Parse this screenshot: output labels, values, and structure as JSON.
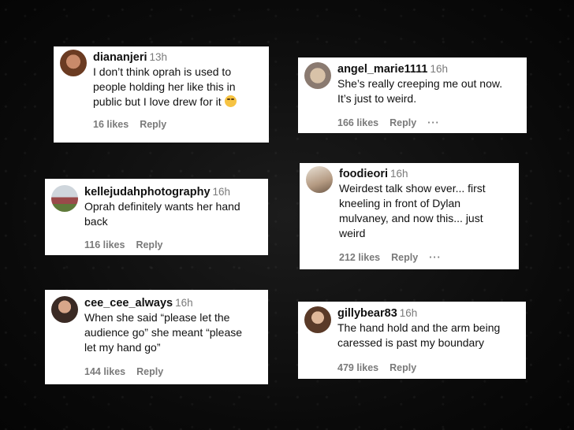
{
  "comments": [
    {
      "user": "diananjeri",
      "time": "13h",
      "lines": [
        "I don’t think oprah is used to",
        "people holding her like this in",
        "public but I love drew for it"
      ],
      "emoji": "joy-emoji-icon",
      "likes": "16 likes",
      "reply": "Reply",
      "more": ""
    },
    {
      "user": "angel_marie1111",
      "time": "16h",
      "lines": [
        "She’s really creeping me out now.",
        "It’s just to weird."
      ],
      "likes": "166 likes",
      "reply": "Reply",
      "more": "···"
    },
    {
      "user": "foodieori",
      "time": "16h",
      "lines": [
        "Weirdest talk show ever... first",
        "kneeling in front of Dylan",
        "mulvaney, and now this... just",
        "weird"
      ],
      "likes": "212 likes",
      "reply": "Reply",
      "more": "···"
    },
    {
      "user": "kellejudahphotography",
      "time": "16h",
      "lines": [
        "Oprah definitely wants her hand",
        "back"
      ],
      "likes": "116 likes",
      "reply": "Reply",
      "more": ""
    },
    {
      "user": "cee_cee_always",
      "time": "16h",
      "lines": [
        "When she said “please let the",
        "audience go” she meant “please",
        "let my hand go”"
      ],
      "likes": "144 likes",
      "reply": "Reply",
      "more": ""
    },
    {
      "user": "gillybear83",
      "time": "16h",
      "lines": [
        "The hand hold and the arm being",
        "caressed is past my boundary"
      ],
      "likes": "479 likes",
      "reply": "Reply",
      "more": ""
    }
  ],
  "colors": {
    "card": "#ffffff",
    "background": "#0d0d0d",
    "muted": "#7a7a7a"
  }
}
